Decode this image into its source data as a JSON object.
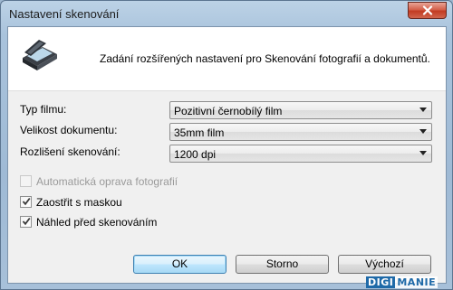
{
  "window": {
    "title": "Nastavení skenování",
    "close_icon": "close-icon"
  },
  "header": {
    "icon": "scanner-icon",
    "description": "Zadání rozšířených nastavení pro Skenování fotografií a dokumentů."
  },
  "settings": {
    "film_type": {
      "label": "Typ filmu:",
      "value": "Pozitivní černobílý film"
    },
    "document_size": {
      "label": "Velikost dokumentu:",
      "value": "35mm film"
    },
    "resolution": {
      "label": "Rozlišení skenování:",
      "value": "1200 dpi"
    }
  },
  "options": {
    "auto_fix": {
      "label": "Automatická oprava fotografií",
      "checked": false,
      "enabled": false
    },
    "unsharp_mask": {
      "label": "Zaostřit s maskou",
      "checked": true,
      "enabled": true
    },
    "preview": {
      "label": "Náhled před skenováním",
      "checked": true,
      "enabled": true
    }
  },
  "buttons": {
    "ok": "OK",
    "cancel": "Storno",
    "default": "Výchozí"
  },
  "watermark": {
    "part1": "DIGI",
    "part2": "MANIE"
  }
}
